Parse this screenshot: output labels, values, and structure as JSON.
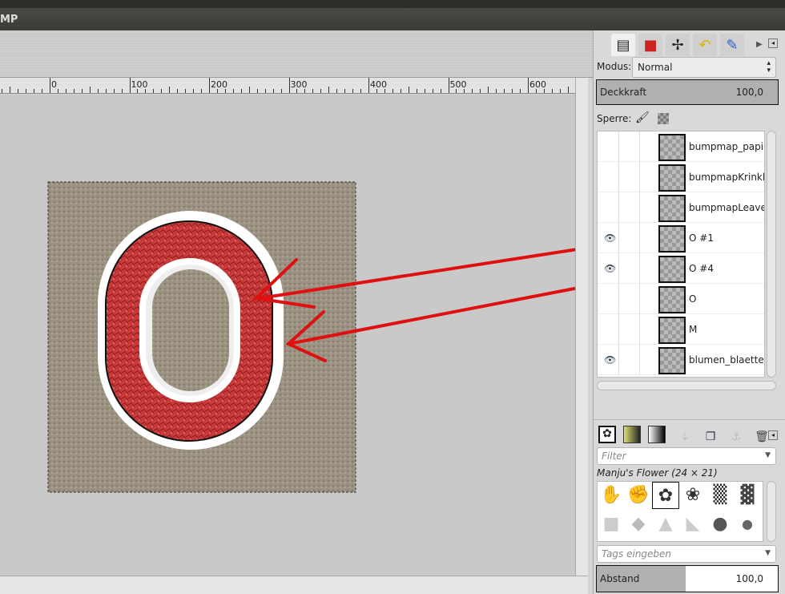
{
  "app": {
    "title_fragment": "MP"
  },
  "ruler": {
    "labels": [
      "0",
      "100",
      "200",
      "300",
      "400",
      "500",
      "600"
    ]
  },
  "layers_panel": {
    "mode_label": "Modus:",
    "mode_value": "Normal",
    "opacity_label": "Deckkraft",
    "opacity_value": "100,0",
    "opacity_fraction": 1.0,
    "lock_label": "Sperre:",
    "layers": [
      {
        "name": "bumpmap_papier",
        "visible": false
      },
      {
        "name": "bumpmapKrinkle",
        "visible": false
      },
      {
        "name": "bumpmapLeaves",
        "visible": false
      },
      {
        "name": "O #1",
        "visible": true
      },
      {
        "name": "O #4",
        "visible": true
      },
      {
        "name": "O",
        "visible": false
      },
      {
        "name": "M",
        "visible": false
      },
      {
        "name": "blumen_blaetter",
        "visible": true
      }
    ]
  },
  "brushes_panel": {
    "filter_placeholder": "Filter",
    "selected_brush": "Manju's Flower (24 × 21)",
    "tags_placeholder": "Tags eingeben",
    "spacing_label": "Abstand",
    "spacing_value": "100,0",
    "spacing_fraction": 0.49
  },
  "colors": {
    "arrow": "#e01010",
    "accent_red": "#c83a3a"
  }
}
